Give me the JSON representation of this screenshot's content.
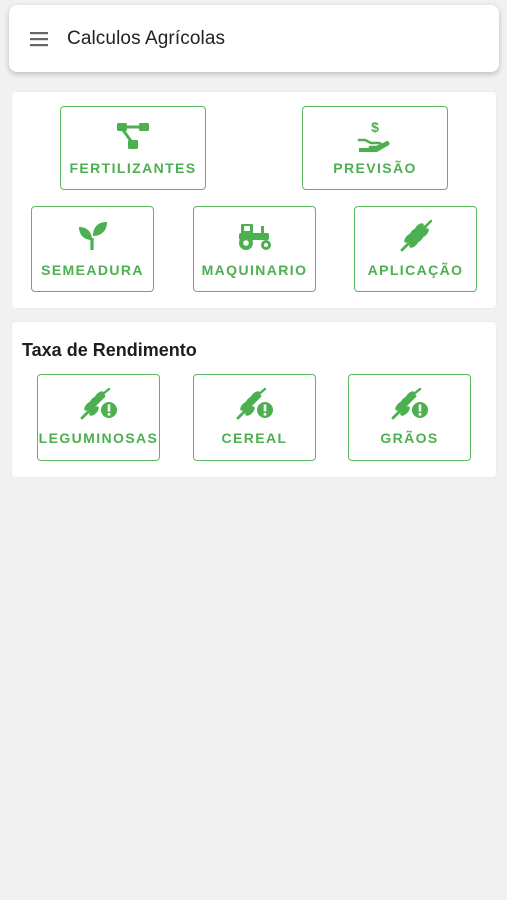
{
  "appbar": {
    "title": "Calculos Agrícolas",
    "menu_icon": "hamburger-menu-icon"
  },
  "calc_card": {
    "tiles": [
      {
        "label": "FERTILIZANTES",
        "icon": "fertilizer-network-icon"
      },
      {
        "label": "PREVISÃO",
        "icon": "hand-money-icon"
      },
      {
        "label": "SEMEADURA",
        "icon": "sprout-icon"
      },
      {
        "label": "MAQUINARIO",
        "icon": "tractor-icon"
      },
      {
        "label": "APLICAÇÃO",
        "icon": "wheat-icon"
      }
    ]
  },
  "yield_card": {
    "title": "Taxa de Rendimento",
    "tiles": [
      {
        "label": "LEGUMINOSAS",
        "icon": "wheat-alert-icon"
      },
      {
        "label": "CEREAL",
        "icon": "wheat-alert-icon"
      },
      {
        "label": "GRÃOS",
        "icon": "wheat-alert-icon"
      }
    ]
  },
  "colors": {
    "accent": "#4caf50",
    "background": "#f1f1f1",
    "card": "#ffffff"
  }
}
